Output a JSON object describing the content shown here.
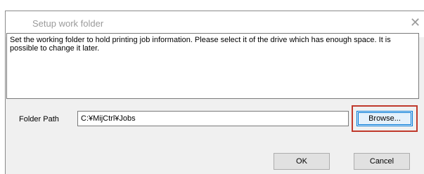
{
  "dialog": {
    "title": "Setup work folder",
    "close_glyph": "✕",
    "message": "Set the working folder to hold printing job information. Please select it of the drive which has enough space. It is possible to change it later."
  },
  "folder": {
    "label": "Folder Path",
    "value": "C:¥MijCtrl¥Jobs",
    "browse_label": "Browse..."
  },
  "buttons": {
    "ok": "OK",
    "cancel": "Cancel"
  },
  "colors": {
    "highlight": "#c0392b",
    "focus_border": "#0078d7"
  }
}
